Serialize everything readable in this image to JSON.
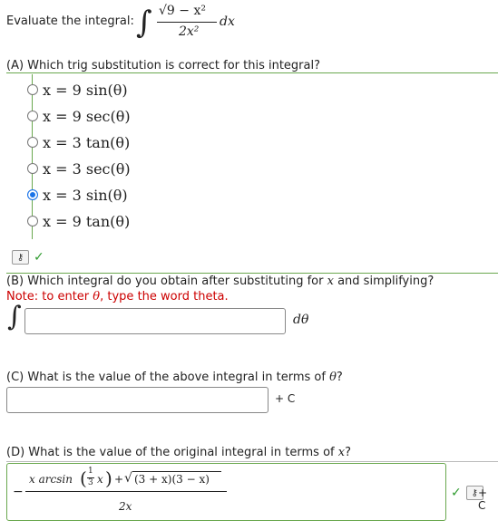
{
  "header": {
    "prompt": "Evaluate the integral:",
    "integrand_numer": "√9 − x²",
    "integrand_denom": "2x²",
    "dx": "dx"
  },
  "partA": {
    "question": "(A) Which trig substitution is correct for this integral?",
    "choices": [
      {
        "text": "x = 9 sin(θ)",
        "selected": false
      },
      {
        "text": "x = 9 sec(θ)",
        "selected": false
      },
      {
        "text": "x = 3 tan(θ)",
        "selected": false
      },
      {
        "text": "x = 3 sec(θ)",
        "selected": false
      },
      {
        "text": "x = 3 sin(θ)",
        "selected": true
      },
      {
        "text": "x = 9 tan(θ)",
        "selected": false
      }
    ],
    "status": "correct"
  },
  "partB": {
    "question_pre": "(B) Which integral do you obtain after substituting for",
    "question_var": "x",
    "question_post": "and simplifying?",
    "note_pre": "Note: to enter",
    "note_var": "θ",
    "note_post": ", type the word theta.",
    "integral_sign": "∫",
    "dtheta": "dθ",
    "input_value": ""
  },
  "partC": {
    "question_pre": "(C) What is the value of the above integral in terms of",
    "question_var": "θ",
    "question_post": "?",
    "input_value": "",
    "plus_c": "+ C"
  },
  "partD": {
    "question_pre": "(D) What is the value of the original integral in terms of",
    "question_var": "x",
    "question_post": "?",
    "answer_numer_a": "x arcsin",
    "answer_frac_n": "1",
    "answer_frac_d": "3",
    "answer_x": "x",
    "answer_plus": "+",
    "answer_sqrt": "(3 + x)(3 − x)",
    "answer_denom": "2x",
    "minus": "−",
    "plus_c": "+ C",
    "status": "correct"
  },
  "colors": {
    "accent_green": "#6aa84f",
    "selected_blue": "#1a73e8",
    "note_red": "#cc0000"
  },
  "icons": [
    "key-icon",
    "check-icon"
  ]
}
